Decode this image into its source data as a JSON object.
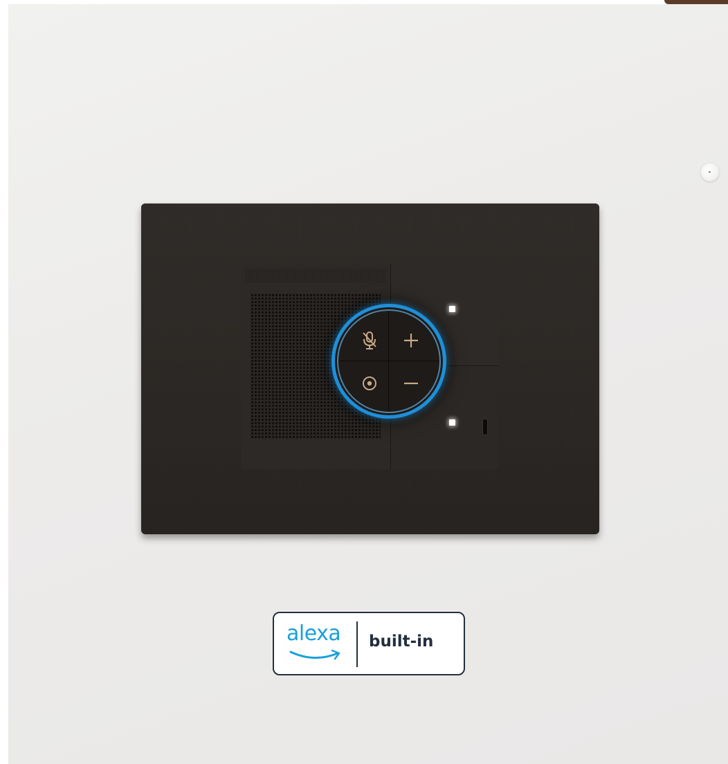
{
  "badge": {
    "brand": "alexa",
    "label": "built-in"
  },
  "device": {
    "buttons": [
      {
        "icon": "mic-mute-icon"
      },
      {
        "icon": "plus-icon"
      },
      {
        "icon": "action-icon"
      },
      {
        "icon": "minus-icon"
      }
    ],
    "ring_color": "#1f8fd8",
    "icon_color": "#c8aa85",
    "plate_color": "#2a2623"
  }
}
